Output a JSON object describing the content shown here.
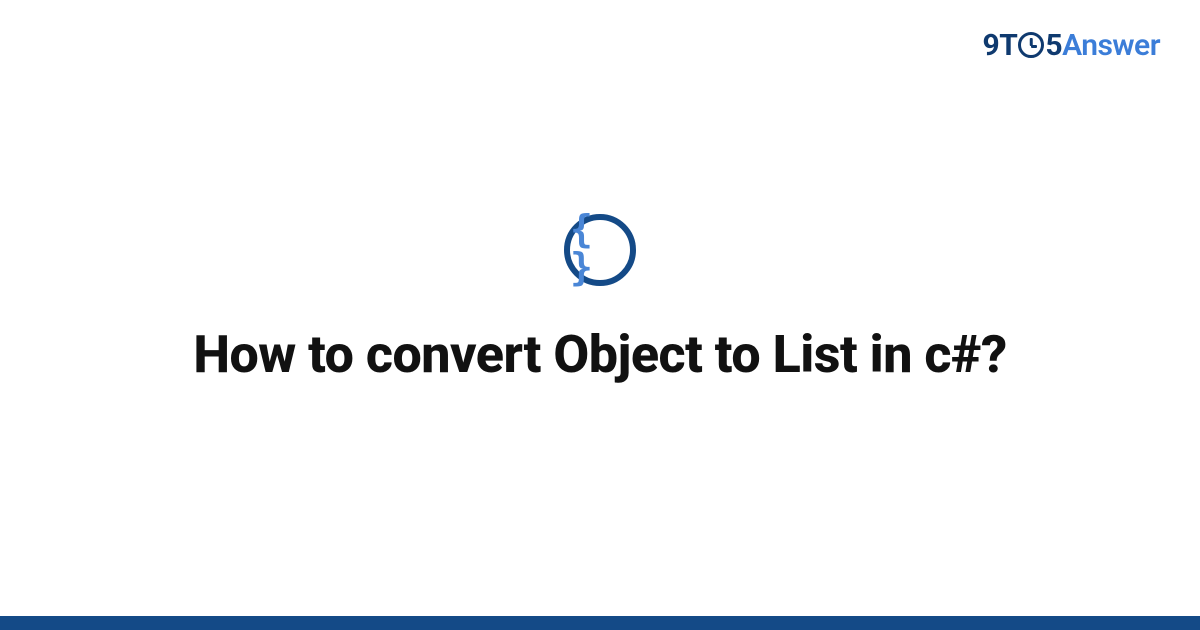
{
  "logo": {
    "part_nine": "9",
    "part_t": "T",
    "part_five": "5",
    "part_answer": "Answer"
  },
  "badge": {
    "glyph": "{ }",
    "name": "code-braces-icon"
  },
  "title": "How to convert Object to List in c#?",
  "colors": {
    "brand_dark": "#144a87",
    "brand_light": "#3b7dd8",
    "text": "#111111"
  }
}
